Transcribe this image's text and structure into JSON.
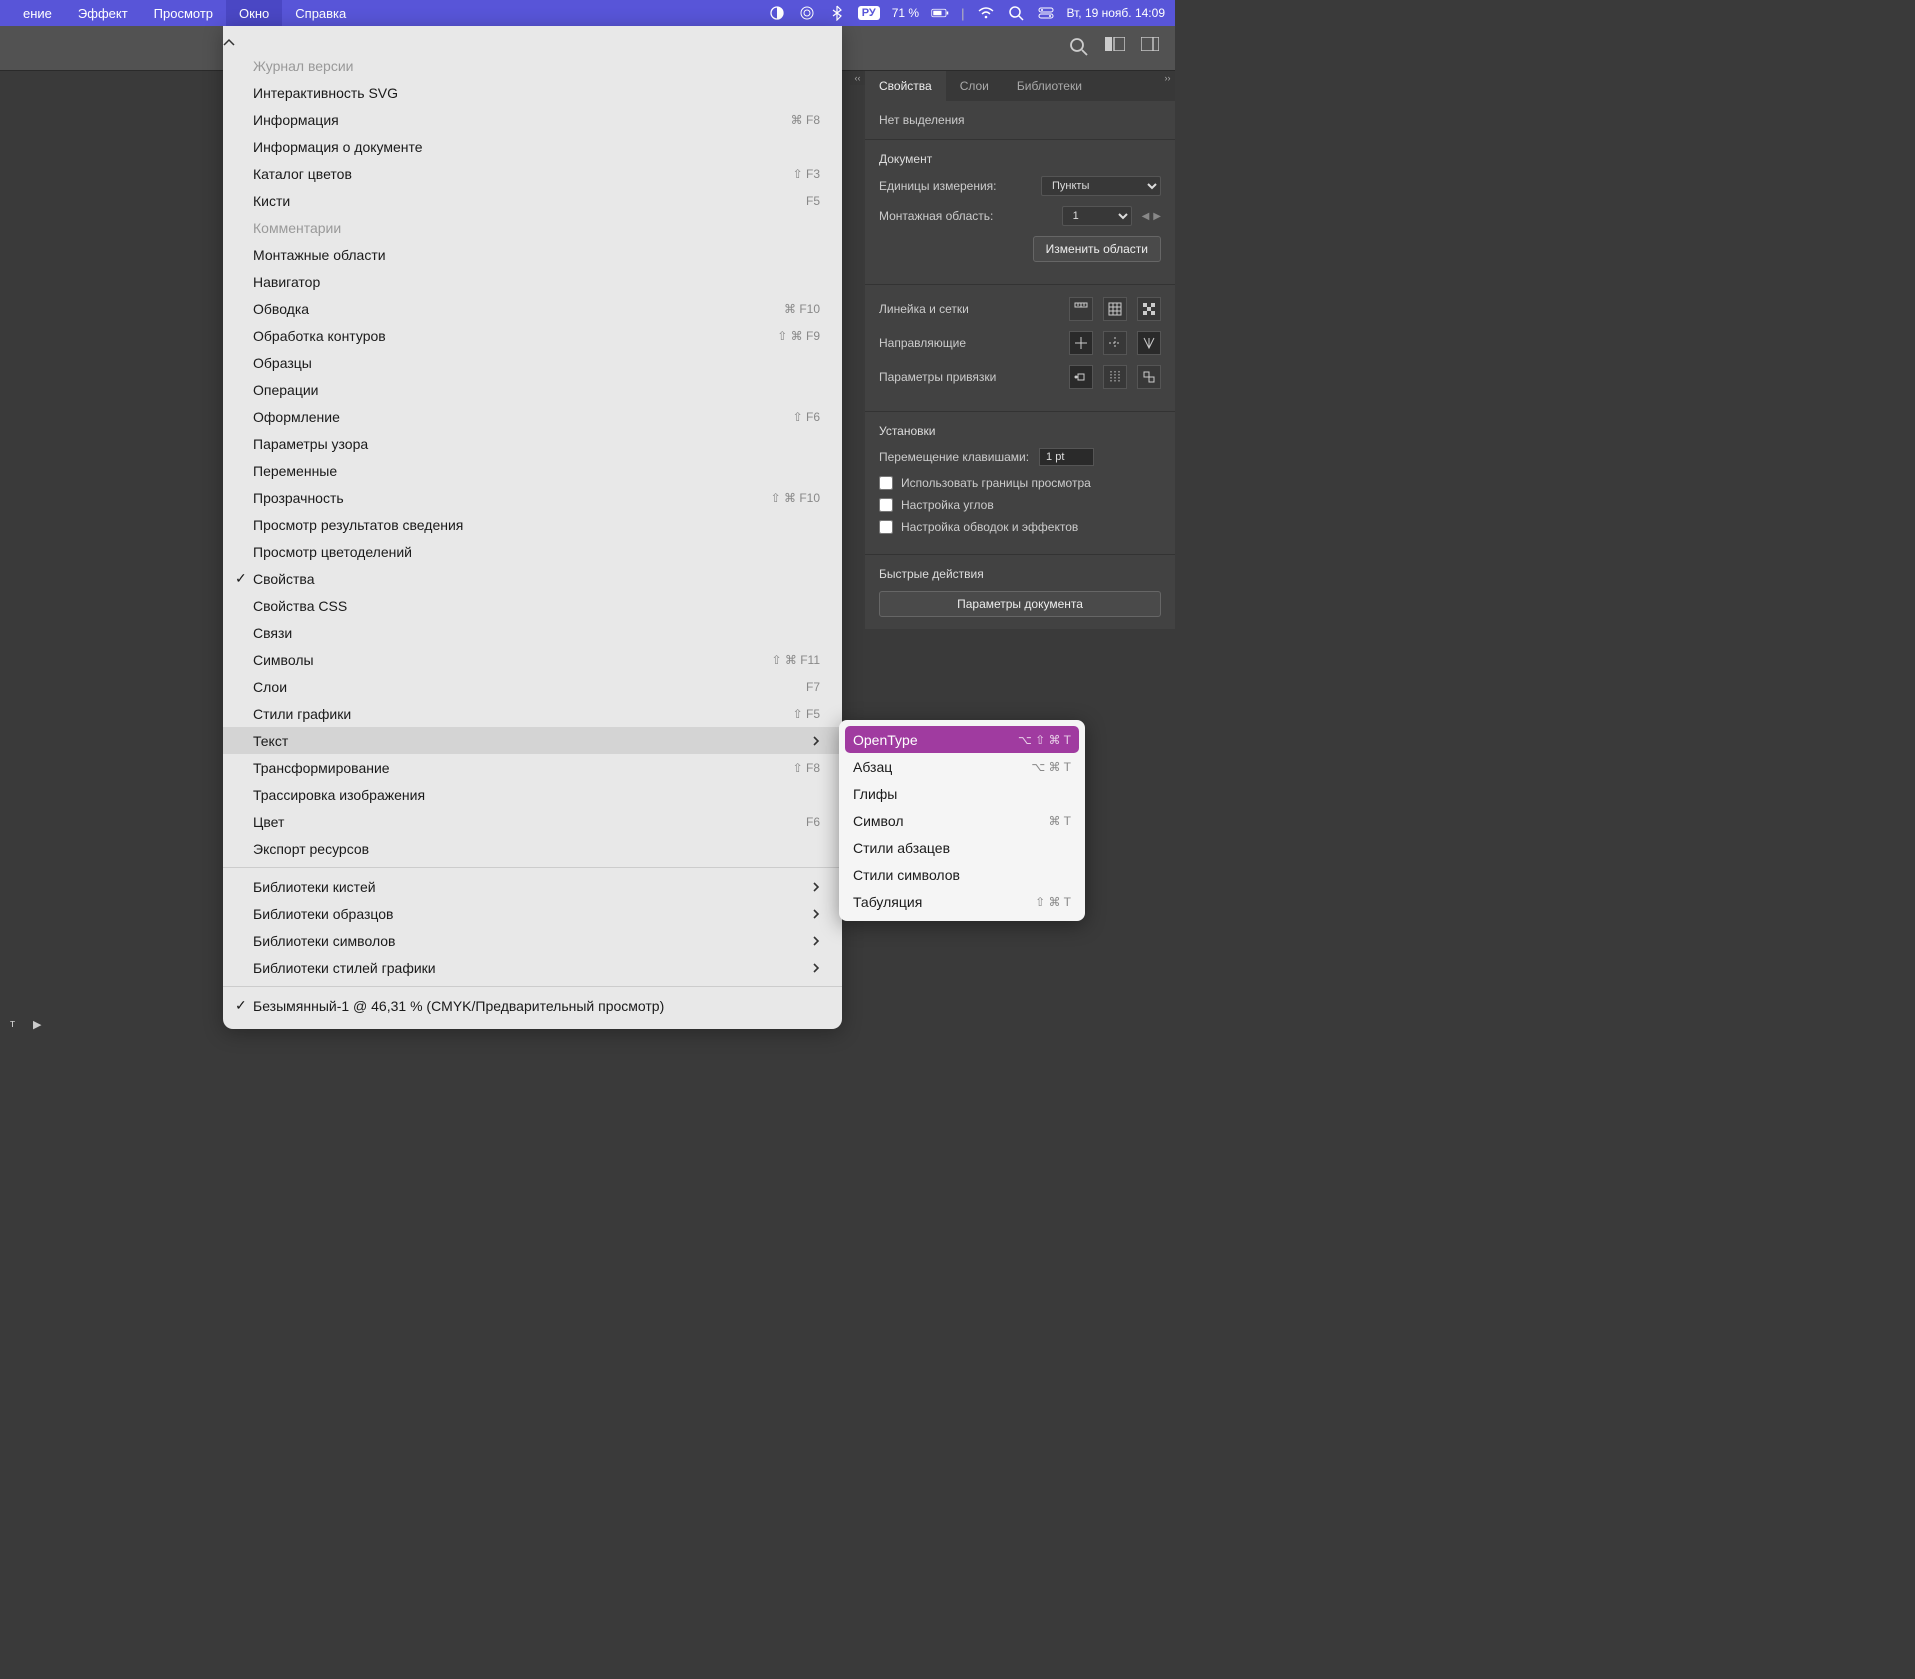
{
  "menubar": {
    "items": [
      "ение",
      "Эффект",
      "Просмотр",
      "Окно",
      "Справка"
    ],
    "active_index": 3,
    "battery_pct": "71 %",
    "lang": "РУ",
    "datetime": "Вт, 19 нояб.  14:09"
  },
  "dropdown": {
    "items": [
      {
        "label": "Журнал версии",
        "disabled": true
      },
      {
        "label": "Интерактивность SVG"
      },
      {
        "label": "Информация",
        "shortcut": "⌘ F8"
      },
      {
        "label": "Информация о документе"
      },
      {
        "label": "Каталог цветов",
        "shortcut": "⇧ F3"
      },
      {
        "label": "Кисти",
        "shortcut": "F5"
      },
      {
        "label": "Комментарии",
        "disabled": true
      },
      {
        "label": "Монтажные области"
      },
      {
        "label": "Навигатор"
      },
      {
        "label": "Обводка",
        "shortcut": "⌘ F10"
      },
      {
        "label": "Обработка контуров",
        "shortcut": "⇧ ⌘ F9"
      },
      {
        "label": "Образцы"
      },
      {
        "label": "Операции"
      },
      {
        "label": "Оформление",
        "shortcut": "⇧ F6"
      },
      {
        "label": "Параметры узора"
      },
      {
        "label": "Переменные"
      },
      {
        "label": "Прозрачность",
        "shortcut": "⇧ ⌘ F10"
      },
      {
        "label": "Просмотр результатов сведения"
      },
      {
        "label": "Просмотр цветоделений"
      },
      {
        "label": "Свойства",
        "checked": true
      },
      {
        "label": "Свойства CSS"
      },
      {
        "label": "Связи"
      },
      {
        "label": "Символы",
        "shortcut": "⇧ ⌘ F11"
      },
      {
        "label": "Слои",
        "shortcut": "F7"
      },
      {
        "label": "Стили графики",
        "shortcut": "⇧ F5"
      },
      {
        "label": "Текст",
        "arrow": true,
        "hovered": true
      },
      {
        "label": "Трансформирование",
        "shortcut": "⇧ F8"
      },
      {
        "label": "Трассировка изображения"
      },
      {
        "label": "Цвет",
        "shortcut": "F6"
      },
      {
        "label": "Экспорт ресурсов"
      },
      {
        "sep": true
      },
      {
        "label": "Библиотеки кистей",
        "arrow": true
      },
      {
        "label": "Библиотеки образцов",
        "arrow": true
      },
      {
        "label": "Библиотеки символов",
        "arrow": true
      },
      {
        "label": "Библиотеки стилей графики",
        "arrow": true
      },
      {
        "sep": true
      },
      {
        "label": "Безымянный-1 @ 46,31 % (CMYK/Предварительный просмотр)",
        "checked": true
      }
    ]
  },
  "submenu": {
    "items": [
      {
        "label": "OpenType",
        "shortcut": "⌥ ⇧ ⌘ T",
        "selected": true
      },
      {
        "label": "Абзац",
        "shortcut": "⌥ ⌘ T"
      },
      {
        "label": "Глифы"
      },
      {
        "label": "Символ",
        "shortcut": "⌘ T"
      },
      {
        "label": "Стили абзацев"
      },
      {
        "label": "Стили символов"
      },
      {
        "label": "Табуляция",
        "shortcut": "⇧ ⌘ T"
      }
    ]
  },
  "panel": {
    "tabs": [
      "Свойства",
      "Слои",
      "Библиотеки"
    ],
    "active_tab": 0,
    "no_selection": "Нет выделения",
    "document": "Документ",
    "units_label": "Единицы измерения:",
    "units_value": "Пункты",
    "artboard_label": "Монтажная область:",
    "artboard_value": "1",
    "edit_artboards": "Изменить области",
    "ruler_grid": "Линейка и сетки",
    "guides": "Направляющие",
    "snap_options": "Параметры привязки",
    "settings": "Установки",
    "keyboard_move_label": "Перемещение клавишами:",
    "keyboard_move_value": "1 pt",
    "cb_preview_bounds": "Использовать границы просмотра",
    "cb_corners": "Настройка углов",
    "cb_strokes": "Настройка обводок и эффектов",
    "quick_actions": "Быстрые действия",
    "doc_params": "Параметры документа"
  },
  "bottom": {
    "t": "т"
  }
}
